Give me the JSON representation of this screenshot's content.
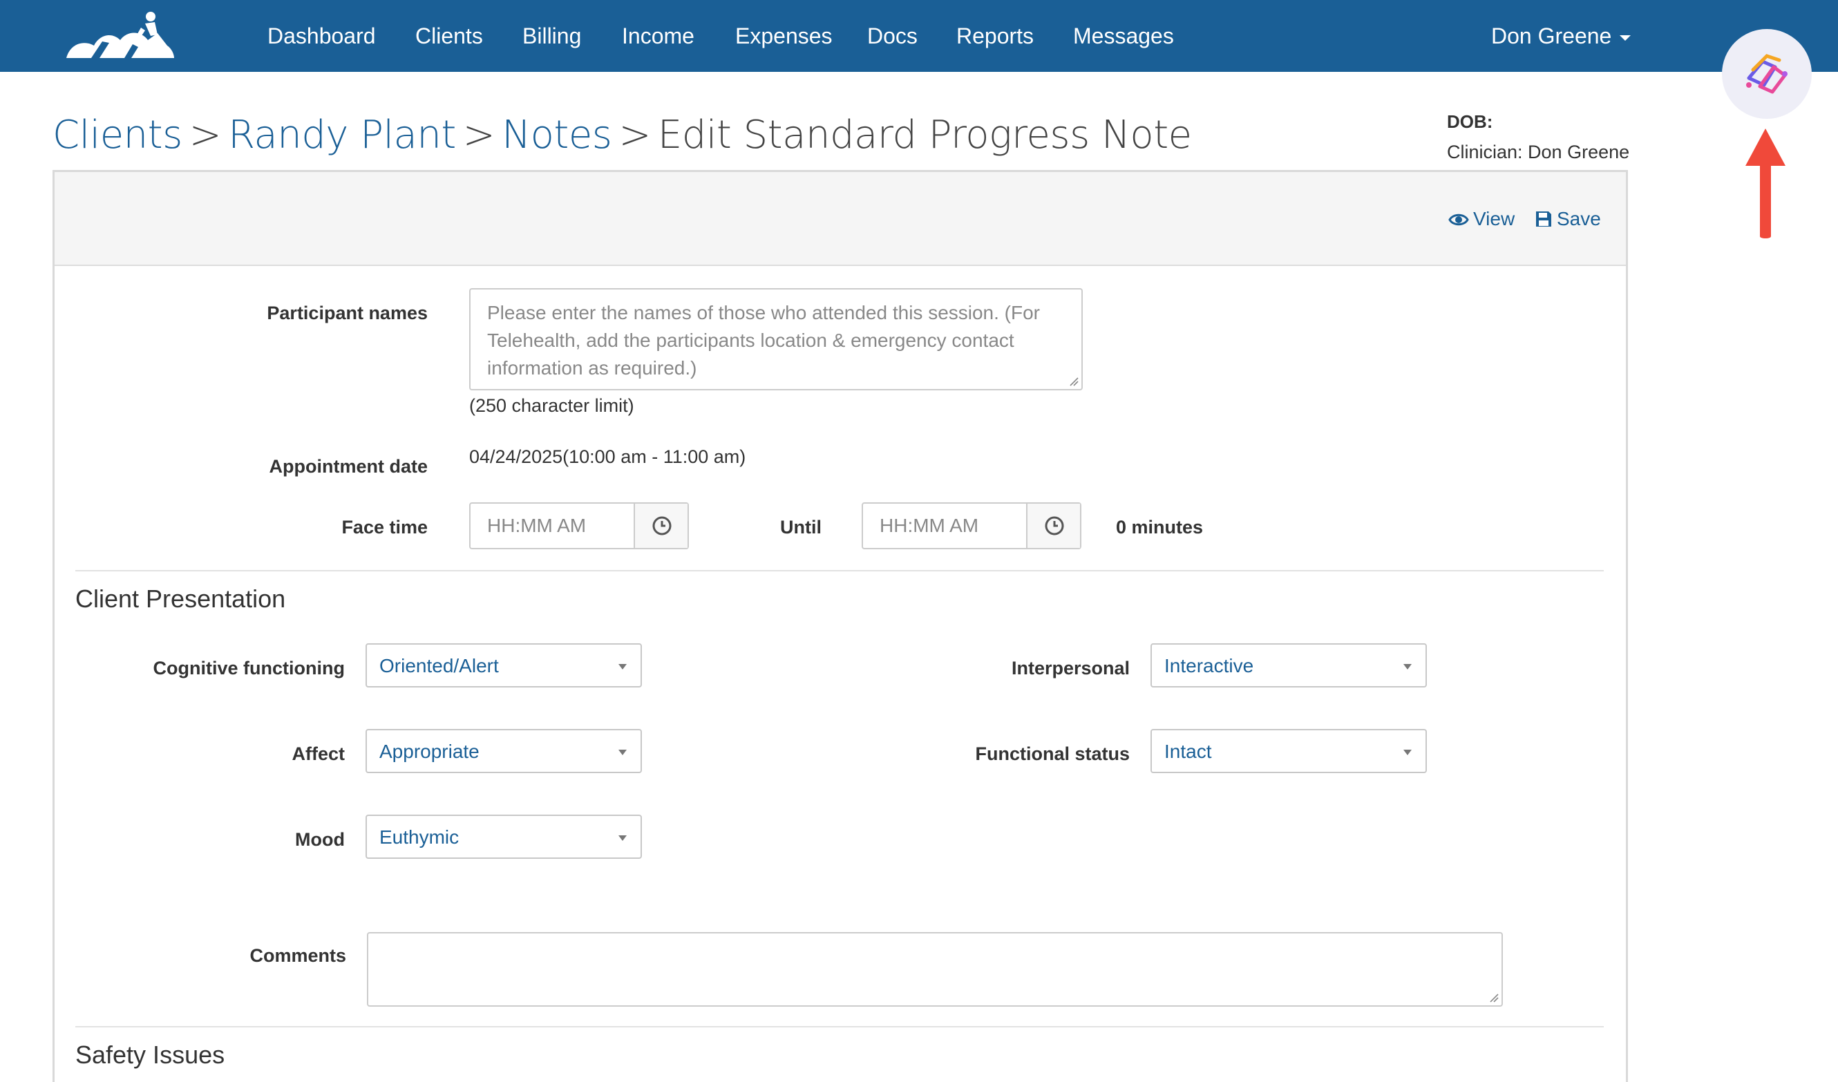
{
  "nav": {
    "items": [
      "Dashboard",
      "Clients",
      "Billing",
      "Income",
      "Expenses",
      "Docs",
      "Reports",
      "Messages"
    ],
    "user": "Don Greene"
  },
  "breadcrumb": {
    "clients": "Clients",
    "client_name": "Randy Plant",
    "notes": "Notes",
    "current": "Edit Standard Progress Note",
    "separator": ">"
  },
  "header_info": {
    "dob_label": "DOB:",
    "clinician": "Clinician: Don Greene"
  },
  "actions": {
    "view": "View",
    "save": "Save"
  },
  "form": {
    "participant_names": {
      "label": "Participant names",
      "placeholder": "Please enter the names of those who attended this session. (For Telehealth, add the participants location & emergency contact information as required.)",
      "hint": "(250 character limit)"
    },
    "appointment_date": {
      "label": "Appointment date",
      "value": "04/24/2025(10:00 am - 11:00 am)"
    },
    "face_time": {
      "label": "Face time",
      "placeholder": "HH:MM AM",
      "until_label": "Until",
      "until_placeholder": "HH:MM AM",
      "duration": "0 minutes"
    }
  },
  "client_presentation": {
    "title": "Client Presentation",
    "cognitive_functioning": {
      "label": "Cognitive functioning",
      "value": "Oriented/Alert"
    },
    "affect": {
      "label": "Affect",
      "value": "Appropriate"
    },
    "mood": {
      "label": "Mood",
      "value": "Euthymic"
    },
    "interpersonal": {
      "label": "Interpersonal",
      "value": "Interactive"
    },
    "functional_status": {
      "label": "Functional status",
      "value": "Intact"
    },
    "comments_label": "Comments"
  },
  "safety": {
    "title": "Safety Issues"
  },
  "colors": {
    "navbar": "#1a5f96",
    "link": "#1a5f96",
    "arrow": "#f0493a"
  },
  "icons": [
    "logo",
    "assistant-icon",
    "eye-icon",
    "floppy-disk-icon",
    "clock-icon",
    "caret-down-icon",
    "red-arrow-icon"
  ]
}
